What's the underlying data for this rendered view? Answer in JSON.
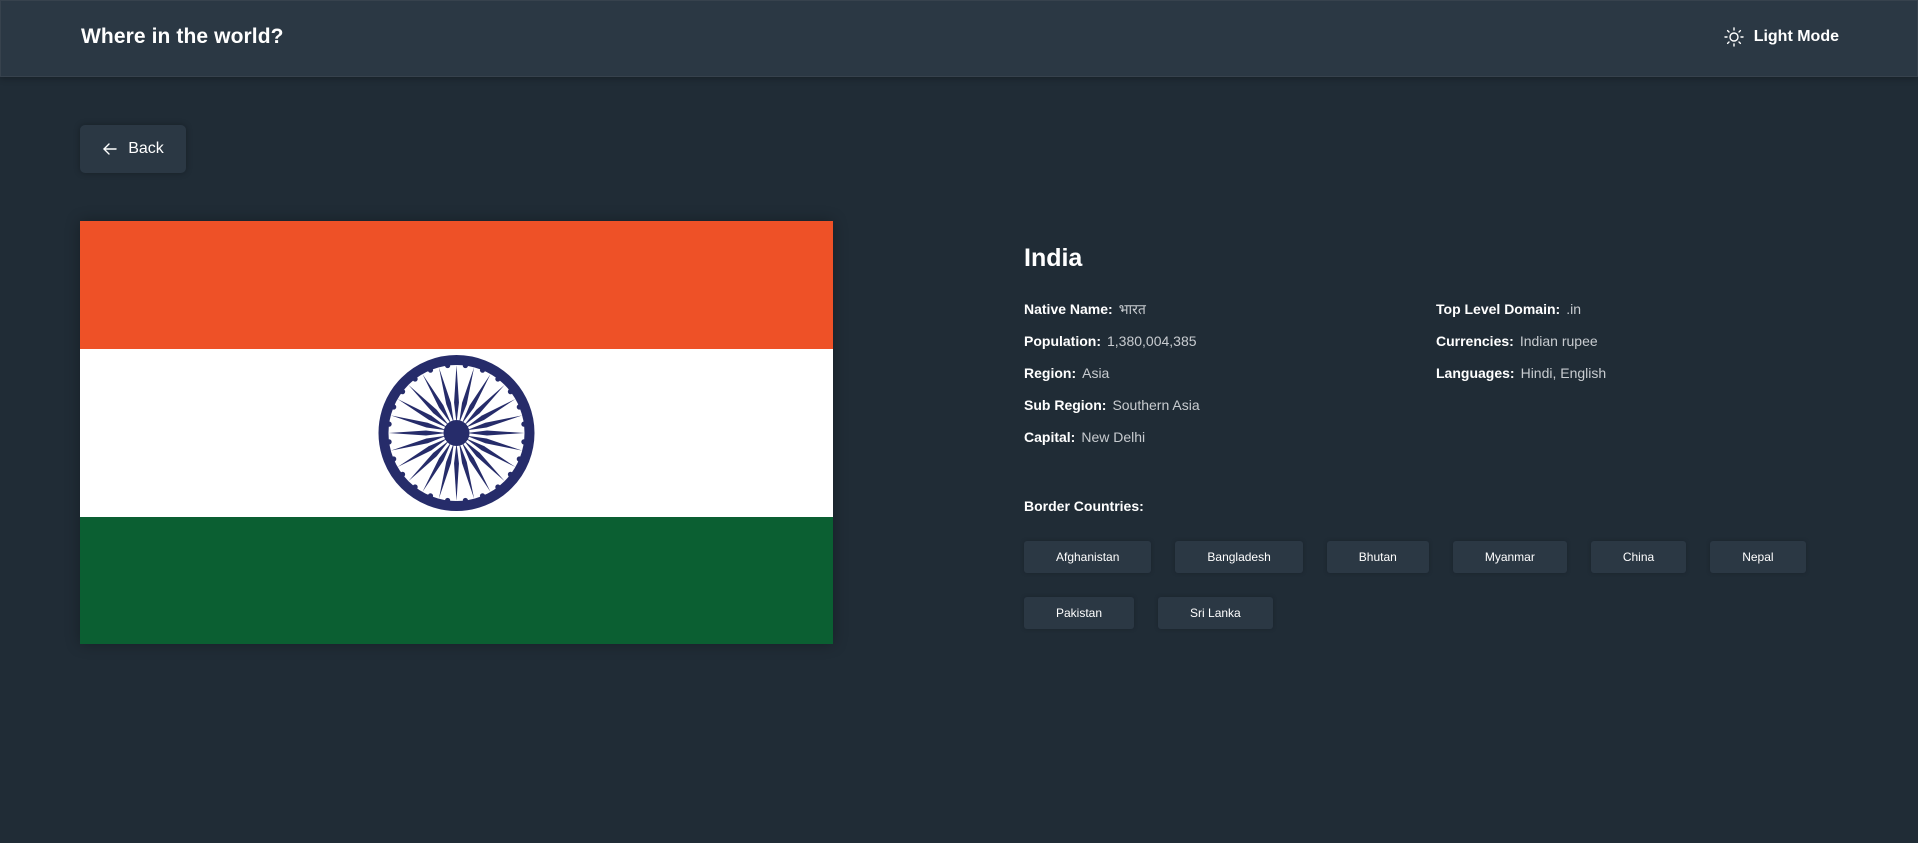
{
  "header": {
    "title": "Where in the world?",
    "theme_toggle_label": "Light Mode",
    "theme_icon": "sun-icon"
  },
  "back_button": {
    "label": "Back",
    "icon": "arrow-left-icon"
  },
  "flag": {
    "alt": "Flag of India",
    "colors": {
      "top": "#ee5127",
      "middle": "#ffffff",
      "bottom": "#0b5f32",
      "wheel": "#262c6a"
    }
  },
  "country": {
    "name": "India",
    "left_info": [
      {
        "key": "Native Name:",
        "value": "भारत"
      },
      {
        "key": "Population:",
        "value": "1,380,004,385"
      },
      {
        "key": "Region:",
        "value": "Asia"
      },
      {
        "key": "Sub Region:",
        "value": "Southern Asia"
      },
      {
        "key": "Capital:",
        "value": "New Delhi"
      }
    ],
    "right_info": [
      {
        "key": "Top Level Domain:",
        "value": ".in"
      },
      {
        "key": "Currencies:",
        "value": "Indian rupee"
      },
      {
        "key": "Languages:",
        "value": "Hindi, English"
      }
    ],
    "border_label": "Border Countries:",
    "border_countries": [
      "Afghanistan",
      "Bangladesh",
      "Bhutan",
      "Myanmar",
      "China",
      "Nepal",
      "Pakistan",
      "Sri Lanka"
    ]
  },
  "colors": {
    "background": "#202c36",
    "element": "#2b3844",
    "text": "#ffffff"
  }
}
